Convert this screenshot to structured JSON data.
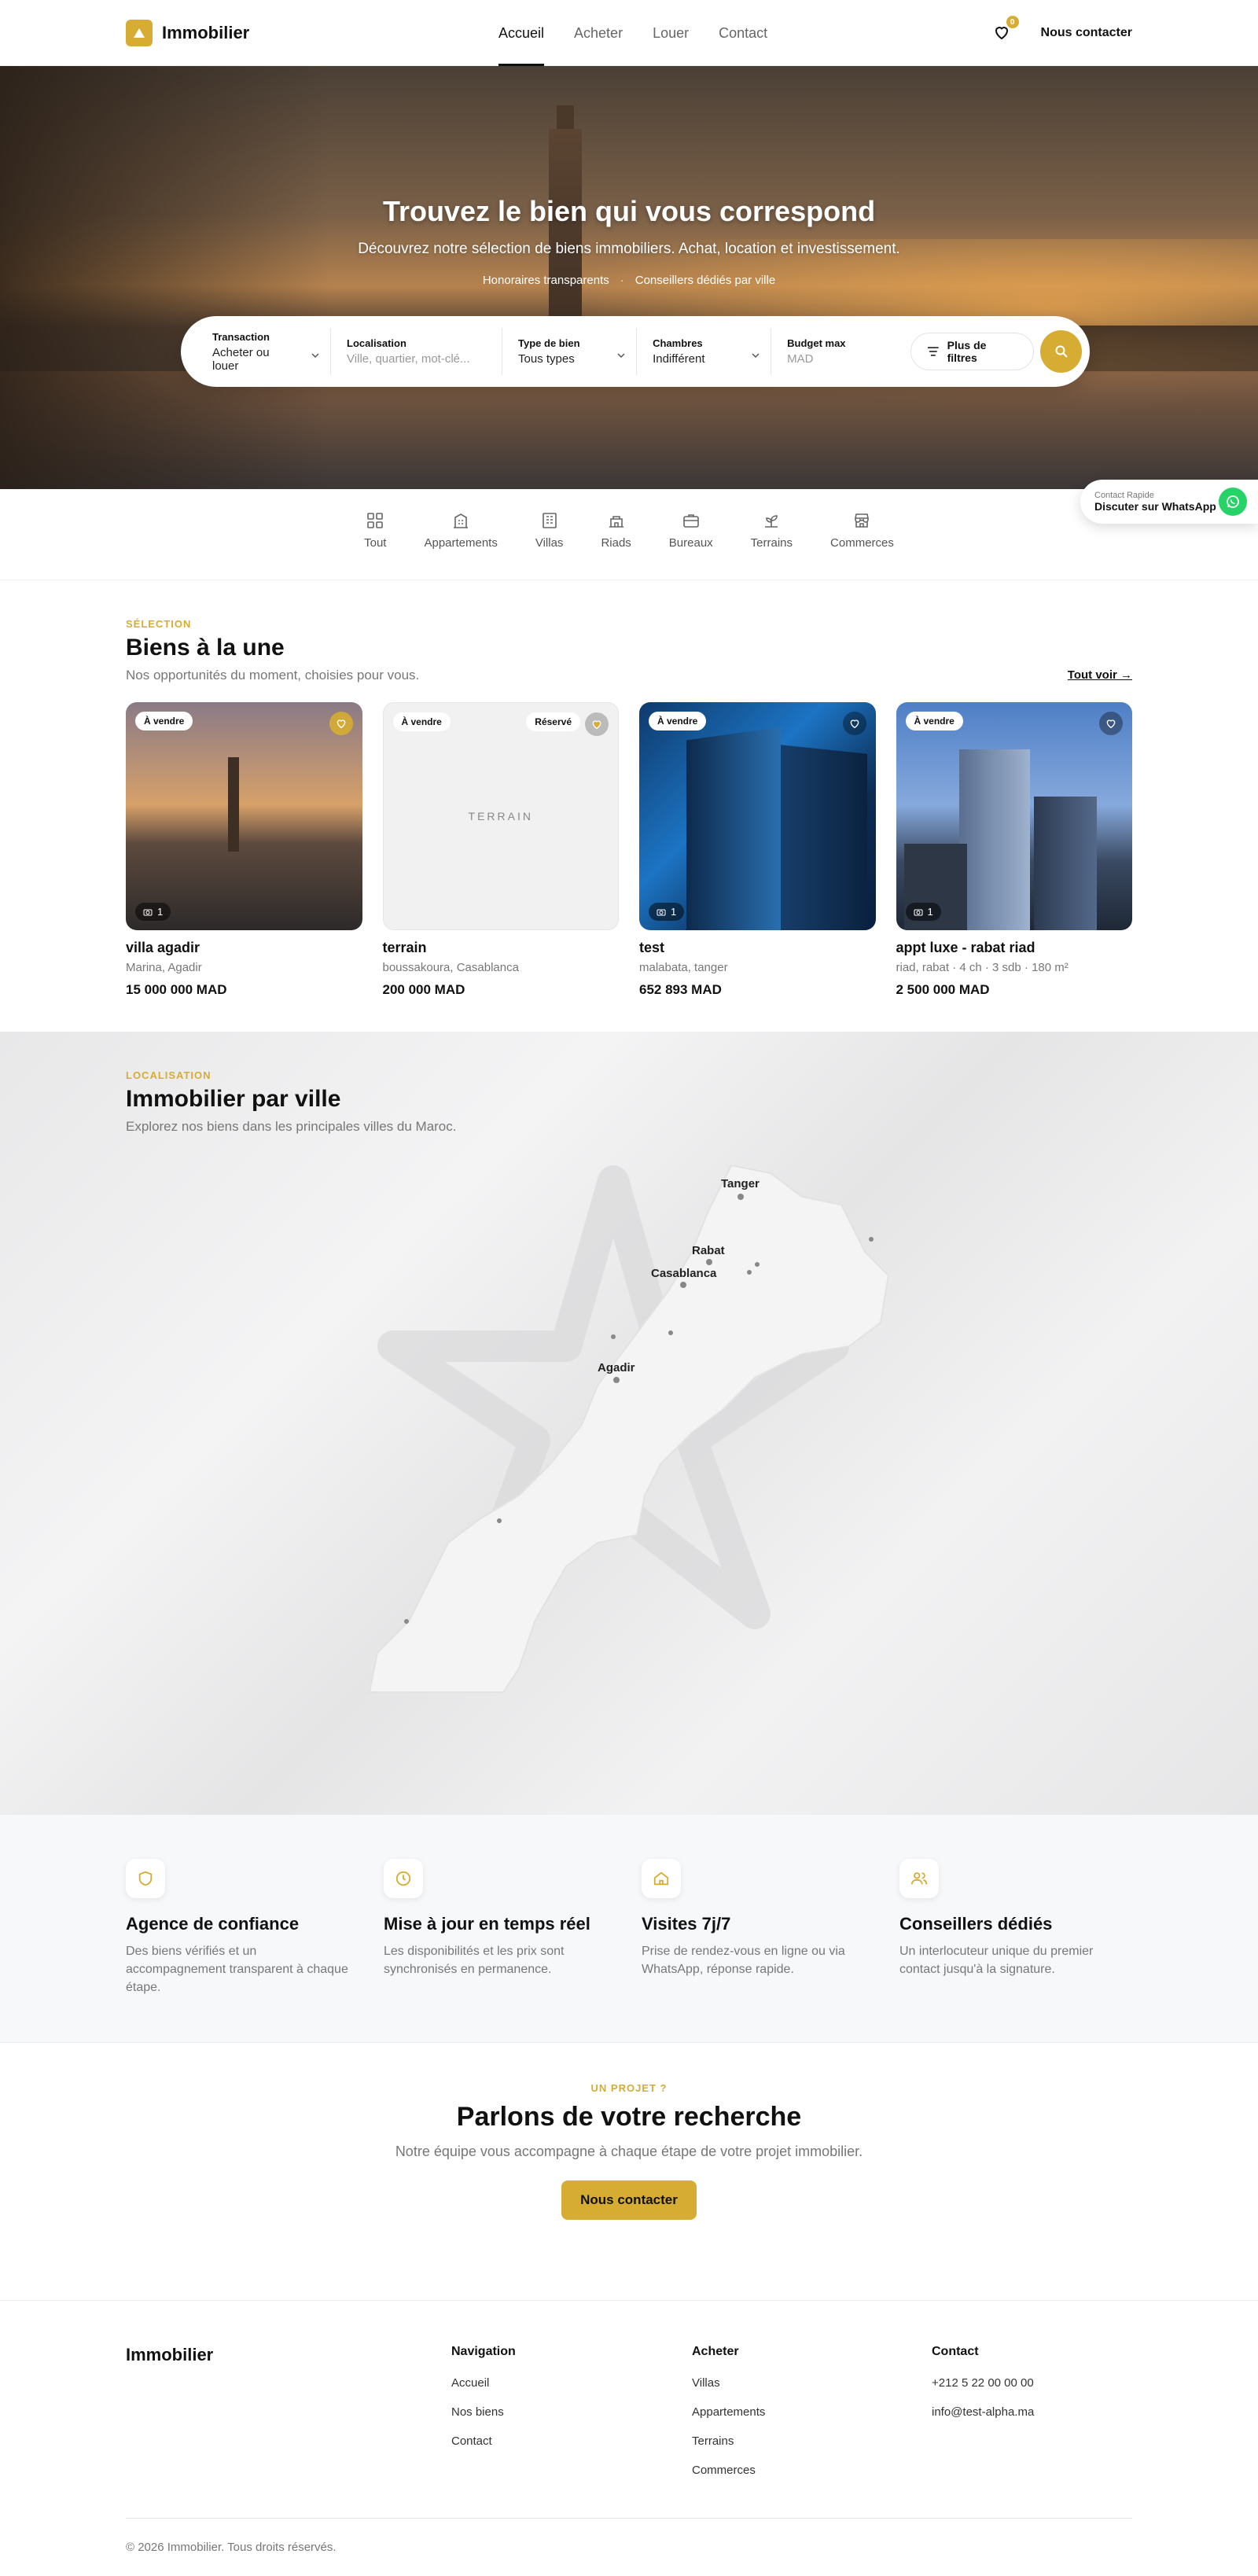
{
  "header": {
    "brand": "Immobilier",
    "nav": [
      "Accueil",
      "Acheter",
      "Louer",
      "Contact"
    ],
    "favorites_count": "0",
    "contact": "Nous contacter"
  },
  "hero": {
    "title": "Trouvez le bien qui vous correspond",
    "subtitle": "Découvrez notre sélection de biens immobiliers. Achat, location et investissement.",
    "tag1": "Honoraires transparents",
    "tag2": "Conseillers dédiés par ville"
  },
  "search": {
    "transaction_label": "Transaction",
    "transaction_value": "Acheter ou louer",
    "location_label": "Localisation",
    "location_placeholder": "Ville, quartier, mot-clé...",
    "type_label": "Type de bien",
    "type_value": "Tous types",
    "rooms_label": "Chambres",
    "rooms_value": "Indifférent",
    "budget_label": "Budget max",
    "budget_placeholder": "MAD",
    "filters": "Plus de filtres"
  },
  "categories": [
    "Tout",
    "Appartements",
    "Villas",
    "Riads",
    "Bureaux",
    "Terrains",
    "Commerces"
  ],
  "whatsapp": {
    "line1": "Contact Rapide",
    "line2": "Discuter sur WhatsApp"
  },
  "featured": {
    "eyebrow": "SÉLECTION",
    "title": "Biens à la une",
    "subtitle": "Nos opportunités du moment, choisies pour vous.",
    "see_all": "Tout voir →",
    "cards": [
      {
        "tag": "À vendre",
        "title": "villa agadir",
        "location": "Marina, Agadir",
        "price": "15 000 000 MAD",
        "photos": "1"
      },
      {
        "tag": "À vendre",
        "tag2": "Réservé",
        "placeholder": "TERRAIN",
        "title": "terrain",
        "location": "boussakoura, Casablanca",
        "price": "200 000 MAD"
      },
      {
        "tag": "À vendre",
        "title": "test",
        "location": "malabata, tanger",
        "price": "652 893 MAD",
        "photos": "1"
      },
      {
        "tag": "À vendre",
        "title": "appt luxe - rabat riad",
        "location": "riad, rabat · 4 ch · 3 sdb · 180 m²",
        "price": "2 500 000 MAD",
        "photos": "1"
      }
    ]
  },
  "cities": {
    "eyebrow": "LOCALISATION",
    "title": "Immobilier par ville",
    "subtitle": "Explorez nos biens dans les principales villes du Maroc.",
    "labels": [
      "Tanger",
      "Rabat",
      "Casablanca",
      "Agadir"
    ]
  },
  "features": [
    {
      "icon": "shield-icon",
      "title": "Agence de confiance",
      "desc": "Des biens vérifiés et un accompagnement transparent à chaque étape."
    },
    {
      "icon": "clock-icon",
      "title": "Mise à jour en temps réel",
      "desc": "Les disponibilités et les prix sont synchronisés en permanence."
    },
    {
      "icon": "home-icon",
      "title": "Visites 7j/7",
      "desc": "Prise de rendez-vous en ligne ou via WhatsApp, réponse rapide."
    },
    {
      "icon": "users-icon",
      "title": "Conseillers dédiés",
      "desc": "Un interlocuteur unique du premier contact jusqu'à la signature."
    }
  ],
  "cta": {
    "eyebrow": "UN PROJET ?",
    "title": "Parlons de votre recherche",
    "subtitle": "Notre équipe vous accompagne à chaque étape de votre projet immobilier.",
    "button": "Nous contacter"
  },
  "footer": {
    "brand": "Immobilier",
    "nav_title": "Navigation",
    "nav": [
      "Accueil",
      "Nos biens",
      "Contact"
    ],
    "buy_title": "Acheter",
    "buy": [
      "Villas",
      "Appartements",
      "Terrains",
      "Commerces"
    ],
    "contact_title": "Contact",
    "phone": "+212 5 22 00 00 00",
    "email": "info@test-alpha.ma",
    "copyright": "© 2026 Immobilier. Tous droits réservés."
  },
  "colors": {
    "accent": "#d6ad32",
    "whatsapp": "#25d366"
  }
}
